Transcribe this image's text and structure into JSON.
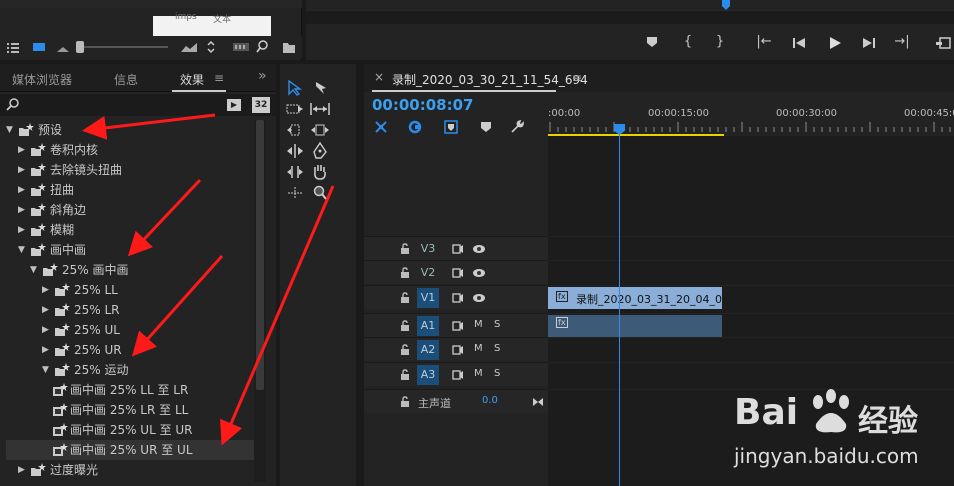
{
  "project": {
    "thumb_text": "imps",
    "cut_text": "文本"
  },
  "effects": {
    "tabs": [
      "媒体浏览器",
      "信息",
      "效果"
    ],
    "menu_icon": "≡",
    "more_icon": "»",
    "badges": [
      "32"
    ],
    "tree": [
      {
        "label": "预设",
        "expanded": true,
        "level": 0,
        "icon": "folder-star"
      },
      {
        "label": "卷积内核",
        "expanded": false,
        "level": 1,
        "icon": "folder-star"
      },
      {
        "label": "去除镜头扭曲",
        "expanded": false,
        "level": 1,
        "icon": "folder-star"
      },
      {
        "label": "扭曲",
        "expanded": false,
        "level": 1,
        "icon": "folder-star"
      },
      {
        "label": "斜角边",
        "expanded": false,
        "level": 1,
        "icon": "folder-star"
      },
      {
        "label": "模糊",
        "expanded": false,
        "level": 1,
        "icon": "folder-star"
      },
      {
        "label": "画中画",
        "expanded": true,
        "level": 1,
        "icon": "folder-star"
      },
      {
        "label": "25% 画中画",
        "expanded": true,
        "level": 2,
        "icon": "folder-star"
      },
      {
        "label": "25% LL",
        "expanded": false,
        "level": 3,
        "icon": "folder-star"
      },
      {
        "label": "25% LR",
        "expanded": false,
        "level": 3,
        "icon": "folder-star"
      },
      {
        "label": "25% UL",
        "expanded": false,
        "level": 3,
        "icon": "folder-star"
      },
      {
        "label": "25% UR",
        "expanded": false,
        "level": 3,
        "icon": "folder-star"
      },
      {
        "label": "25% 运动",
        "expanded": true,
        "level": 3,
        "icon": "folder-star"
      },
      {
        "label": "画中画 25% LL 至 LR",
        "level": 4,
        "icon": "preset-star"
      },
      {
        "label": "画中画 25% LR 至 LL",
        "level": 4,
        "icon": "preset-star"
      },
      {
        "label": "画中画 25% UL 至 UR",
        "level": 4,
        "icon": "preset-star"
      },
      {
        "label": "画中画 25% UR 至 UL",
        "level": 4,
        "icon": "preset-star",
        "selected": true
      },
      {
        "label": "过度曝光",
        "expanded": false,
        "level": 1,
        "icon": "folder-star"
      }
    ]
  },
  "timeline": {
    "close_icon": "×",
    "sequence_name": "录制_2020_03_30_21_11_54_694",
    "menu_icon": "≡",
    "timecode": "00:00:08:07",
    "ruler_labels": [
      ":00:00",
      "00:00:15:00",
      "00:00:30:00",
      "00:00:45:0"
    ],
    "tracks": [
      {
        "name": "V3",
        "type": "video",
        "active": false
      },
      {
        "name": "V2",
        "type": "video",
        "active": false
      },
      {
        "name": "V1",
        "type": "video",
        "active": true
      },
      {
        "name": "A1",
        "type": "audio",
        "active": true
      },
      {
        "name": "A2",
        "type": "audio",
        "active": true
      },
      {
        "name": "A3",
        "type": "audio",
        "active": true
      }
    ],
    "mute_label": "M",
    "solo_label": "S",
    "master_label": "主声道",
    "master_value": "0.0",
    "video_clip_label": "录制_2020_03_31_20_04_0",
    "clip_fx": "fx"
  },
  "watermark": {
    "brand": "Bai",
    "brand2": "经验",
    "url": "jingyan.baidu.com"
  },
  "colors": {
    "accent": "#2d8ceb",
    "timecode": "#3aa0f0",
    "clip_video": "#8aaed8",
    "clip_audio": "#3d5a78",
    "arrow": "#ff1a1a"
  }
}
